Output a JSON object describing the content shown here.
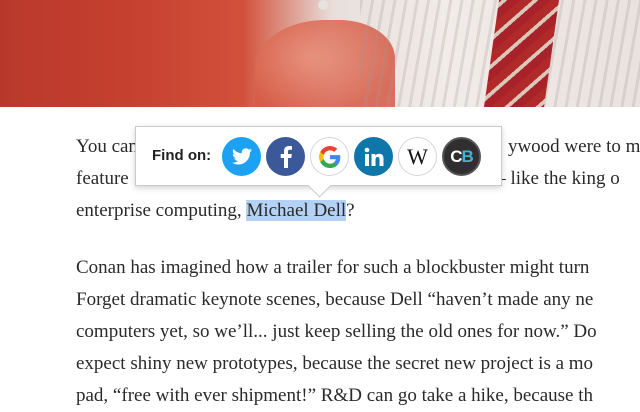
{
  "article": {
    "p1_lines": [
      [
        "You can",
        "",
        "ywood were to m"
      ],
      [
        "feature",
        "",
        "— like the king o"
      ],
      [
        "enterprise computing, ",
        "Michael Dell",
        "?"
      ]
    ],
    "p2_lines": [
      "Conan has imagined how a trailer for such a blockbuster might turn",
      "Forget dramatic keynote scenes, because Dell “haven’t made any ne",
      "computers yet, so we’ll... just keep selling the old ones for now.” Do",
      "expect shiny new prototypes, because the secret new project is a mo",
      "pad, “free with ever shipment!” R&D can go take a hike, because th"
    ]
  },
  "popup": {
    "label": "Find on:",
    "services": [
      {
        "name": "twitter-icon",
        "color": "#1da1f2"
      },
      {
        "name": "facebook-icon",
        "color": "#3b5998"
      },
      {
        "name": "google-icon",
        "color": "#4285f4"
      },
      {
        "name": "linkedin-icon",
        "color": "#0e76a8"
      },
      {
        "name": "wikipedia-icon",
        "glyph": "W"
      },
      {
        "name": "crunchbase-icon",
        "glyph_left": "C",
        "glyph_right": "B"
      }
    ]
  }
}
